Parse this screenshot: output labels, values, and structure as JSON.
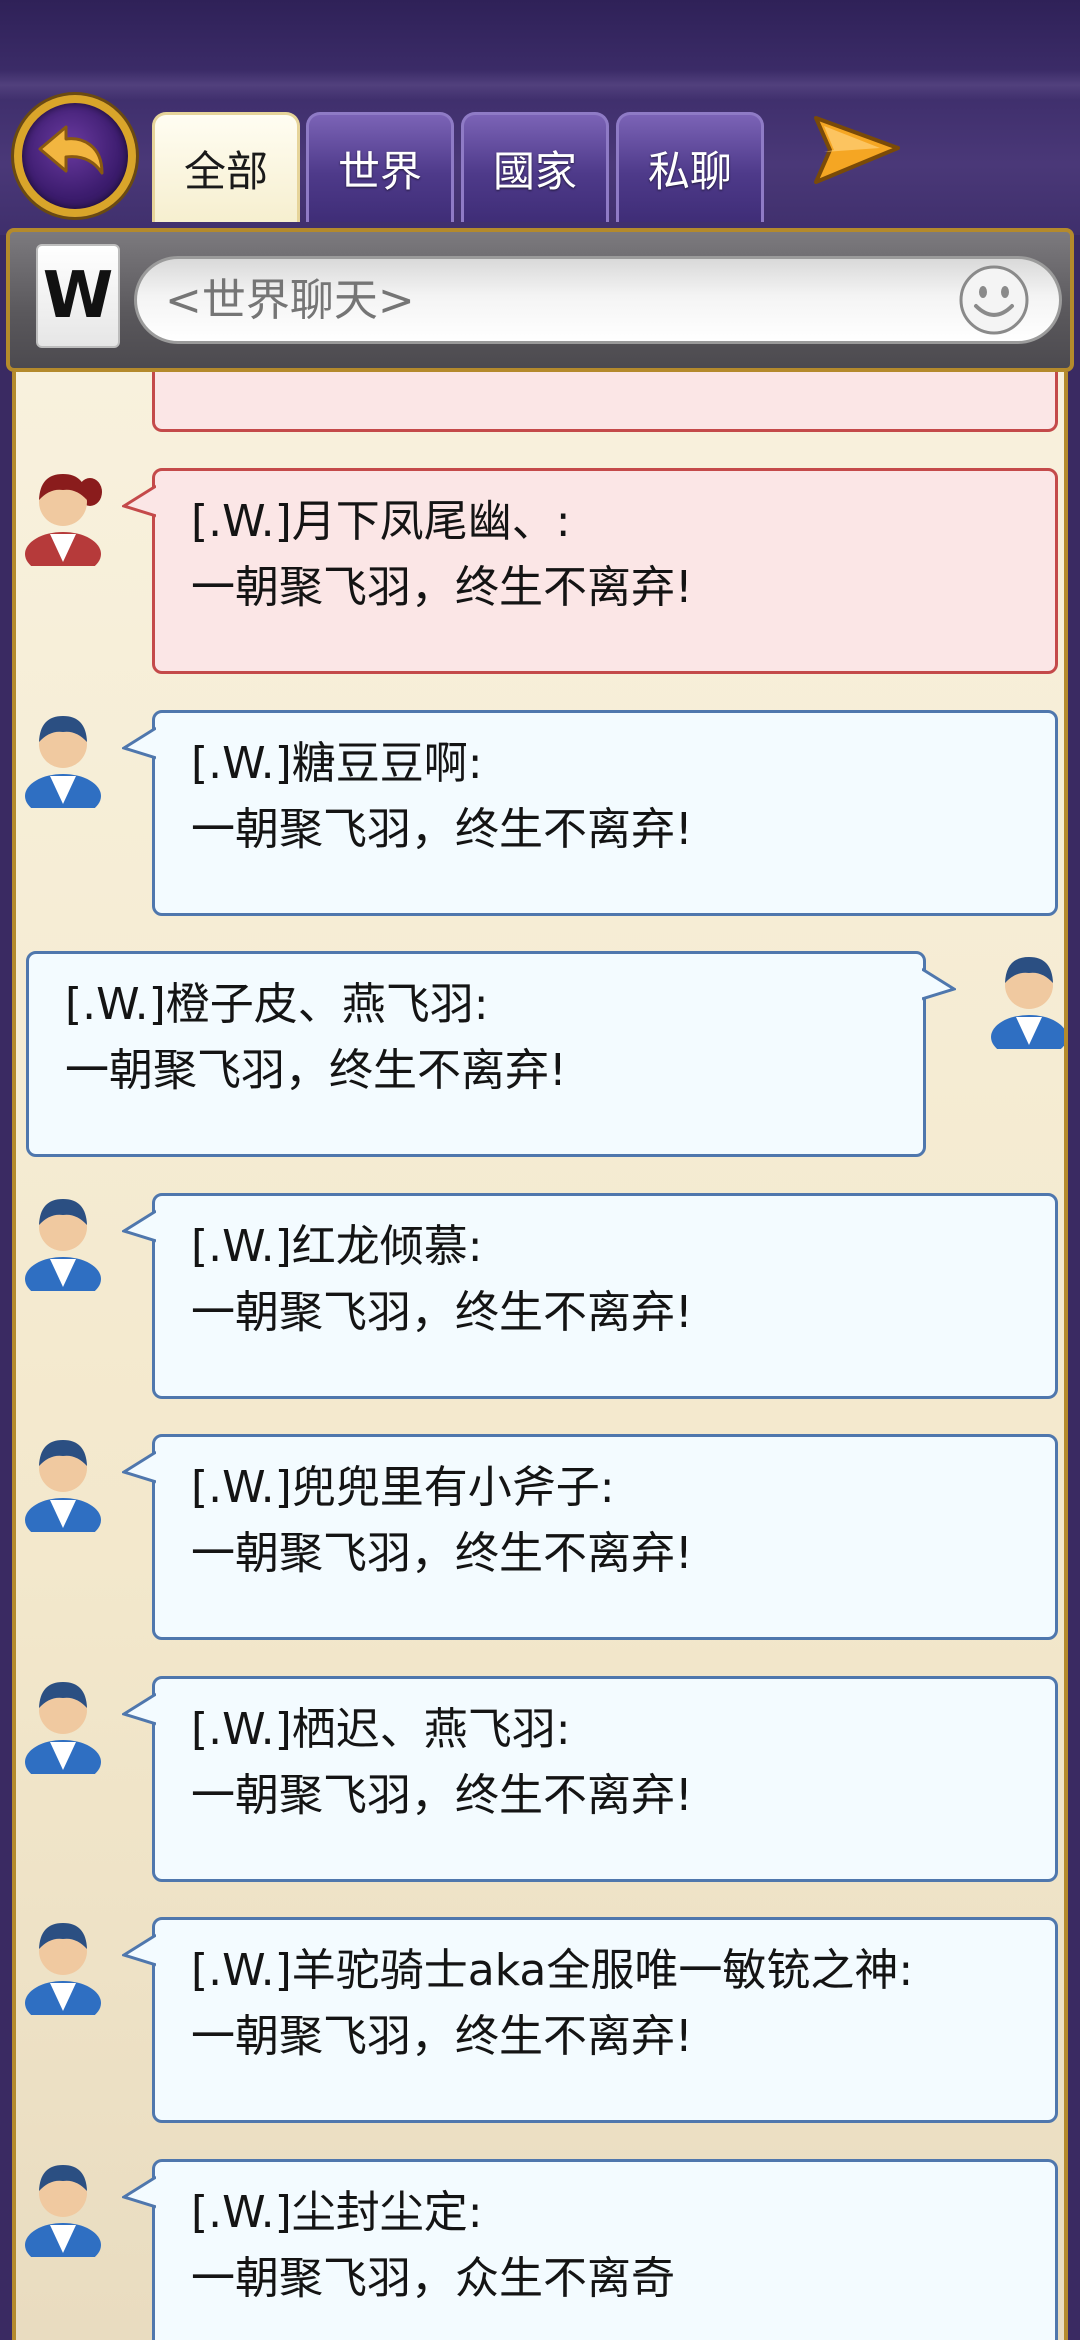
{
  "tabs": [
    {
      "label": "全部",
      "active": true
    },
    {
      "label": "世界",
      "active": false
    },
    {
      "label": "國家",
      "active": false
    },
    {
      "label": "私聊",
      "active": false
    }
  ],
  "channel_badge": "W",
  "chat_input": {
    "placeholder": "<世界聊天>"
  },
  "colors": {
    "header": "#3a2a62",
    "gold_frame": "#b48a2c",
    "bubble_blue": "#f3fbff",
    "bubble_pink": "#fbe6e6"
  },
  "messages": [
    {
      "name": "[.W.]月下凤尾幽、:",
      "text": "一朝聚飞羽，终生不离弃!",
      "style": "pink",
      "side": "left",
      "avatar": "female-avatar-icon"
    },
    {
      "name": "[.W.]糖豆豆啊:",
      "text": "一朝聚飞羽，终生不离弃!",
      "style": "blue",
      "side": "left",
      "avatar": "male-avatar-icon"
    },
    {
      "name": "[.W.]橙子皮、燕飞羽:",
      "text": "一朝聚飞羽，终生不离弃!",
      "style": "blue",
      "side": "right",
      "avatar": "male-avatar-icon"
    },
    {
      "name": "[.W.]红龙倾慕:",
      "text": "一朝聚飞羽，终生不离弃!",
      "style": "blue",
      "side": "left",
      "avatar": "male-avatar-icon"
    },
    {
      "name": "[.W.]兜兜里有小斧子:",
      "text": "一朝聚飞羽，终生不离弃!",
      "style": "blue",
      "side": "left",
      "avatar": "male-avatar-icon"
    },
    {
      "name": "[.W.]栖迟、燕飞羽:",
      "text": "一朝聚飞羽，终生不离弃!",
      "style": "blue",
      "side": "left",
      "avatar": "male-avatar-icon"
    },
    {
      "name": "[.W.]羊驼骑士aka全服唯一敏铳之神:",
      "text": "一朝聚飞羽，终生不离弃!",
      "style": "blue",
      "side": "left",
      "avatar": "male-avatar-icon"
    },
    {
      "name": "[.W.]尘封尘定:",
      "text": "一朝聚飞羽，众生不离奇",
      "style": "blue",
      "side": "left",
      "avatar": "male-avatar-icon"
    }
  ]
}
